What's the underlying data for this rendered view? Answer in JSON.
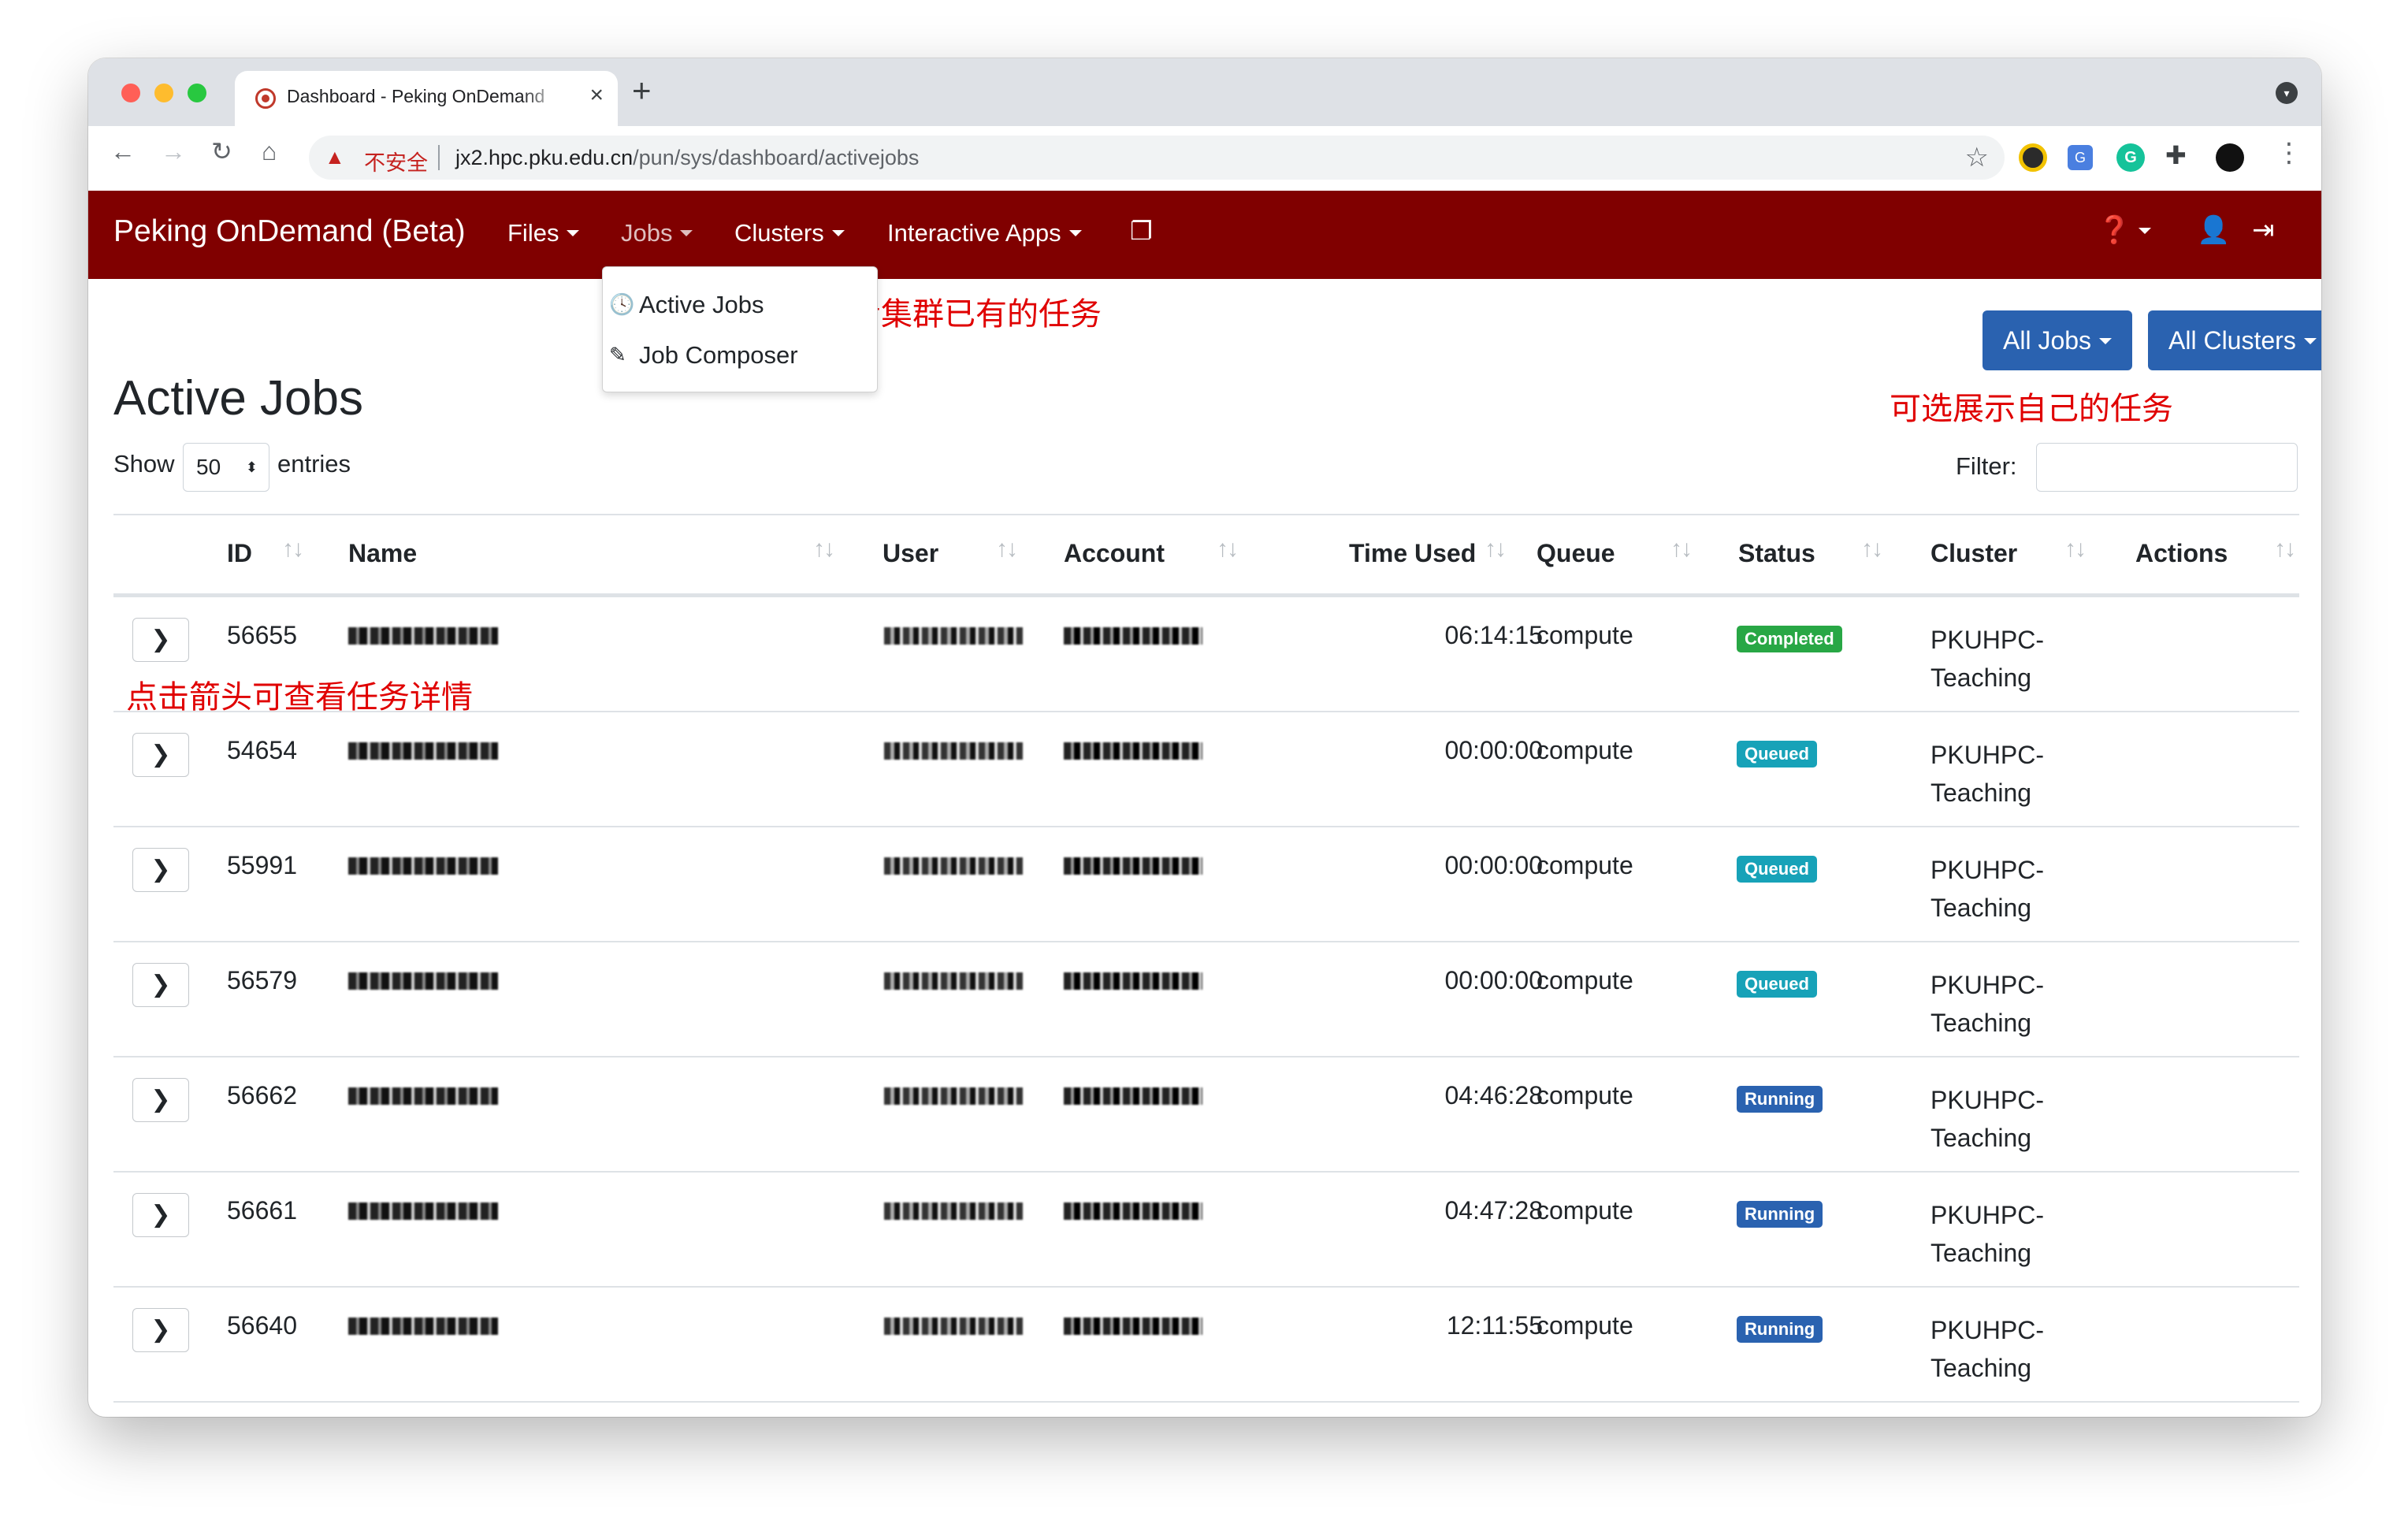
{
  "browser": {
    "tab_title": "Dashboard - Peking OnDemand",
    "tab_close": "×",
    "new_tab": "+",
    "insecure_label": "不安全",
    "url_host": "jx2.hpc.pku.edu.cn",
    "url_path": "/pun/sys/dashboard/activejobs"
  },
  "navbar": {
    "brand": "Peking OnDemand (Beta)",
    "items": [
      {
        "label": "Files"
      },
      {
        "label": "Jobs"
      },
      {
        "label": "Clusters"
      },
      {
        "label": "Interactive Apps"
      }
    ]
  },
  "jobs_menu": {
    "items": [
      {
        "label": "Active Jobs",
        "icon": "clock-icon"
      },
      {
        "label": "Job Composer",
        "icon": "magic-wand-icon"
      }
    ]
  },
  "annotations": {
    "dropdown_note": "查看集群已有的任务",
    "filter_note": "可选展示自己的任务",
    "expand_note": "点击箭头可查看任务详情"
  },
  "page": {
    "title": "Active Jobs",
    "all_jobs_button": "All Jobs",
    "all_clusters_button": "All Clusters",
    "show_label": "Show",
    "entries_select": "50",
    "entries_label": "entries",
    "filter_label": "Filter:",
    "filter_value": ""
  },
  "table": {
    "columns": [
      "ID",
      "Name",
      "User",
      "Account",
      "Time Used",
      "Queue",
      "Status",
      "Cluster",
      "Actions"
    ],
    "rows": [
      {
        "id": "56655",
        "time": "06:14:15",
        "queue": "compute",
        "status": "Completed",
        "cluster": "PKUHPC-\nTeaching"
      },
      {
        "id": "54654",
        "time": "00:00:00",
        "queue": "compute",
        "status": "Queued",
        "cluster": "PKUHPC-\nTeaching"
      },
      {
        "id": "55991",
        "time": "00:00:00",
        "queue": "compute",
        "status": "Queued",
        "cluster": "PKUHPC-\nTeaching"
      },
      {
        "id": "56579",
        "time": "00:00:00",
        "queue": "compute",
        "status": "Queued",
        "cluster": "PKUHPC-\nTeaching"
      },
      {
        "id": "56662",
        "time": "04:46:28",
        "queue": "compute",
        "status": "Running",
        "cluster": "PKUHPC-\nTeaching"
      },
      {
        "id": "56661",
        "time": "04:47:28",
        "queue": "compute",
        "status": "Running",
        "cluster": "PKUHPC-\nTeaching"
      },
      {
        "id": "56640",
        "time": "12:11:55",
        "queue": "compute",
        "status": "Running",
        "cluster": "PKUHPC-\nTeaching"
      }
    ]
  },
  "colors": {
    "navbar": "#800000",
    "primary_button": "#2a62b0",
    "completed": "#28a745",
    "queued": "#17a2b8",
    "running": "#2a62b0",
    "annotation": "#e00000"
  }
}
